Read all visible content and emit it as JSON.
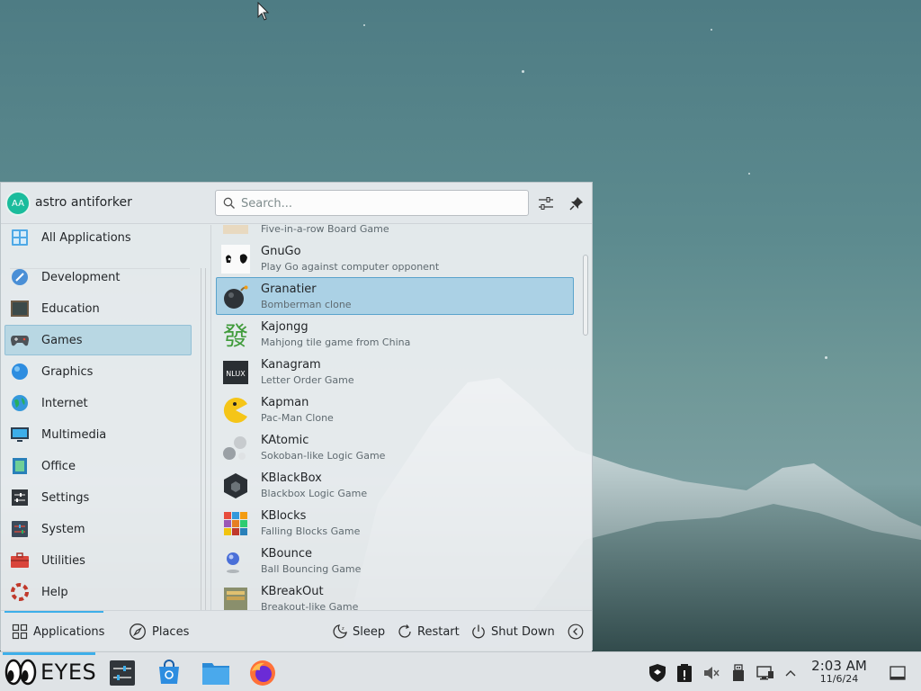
{
  "user": {
    "initials": "AA",
    "name": "astro antiforker"
  },
  "search": {
    "placeholder": "Search..."
  },
  "header_icons": [
    "configure-icon",
    "pin-icon"
  ],
  "categories": [
    {
      "label": "All Applications",
      "icon": "all-apps-icon"
    },
    {
      "label": "Development",
      "icon": "development-icon"
    },
    {
      "label": "Education",
      "icon": "education-icon"
    },
    {
      "label": "Games",
      "icon": "games-icon",
      "selected": true
    },
    {
      "label": "Graphics",
      "icon": "graphics-icon"
    },
    {
      "label": "Internet",
      "icon": "internet-icon"
    },
    {
      "label": "Multimedia",
      "icon": "multimedia-icon"
    },
    {
      "label": "Office",
      "icon": "office-icon"
    },
    {
      "label": "Settings",
      "icon": "settings-icon"
    },
    {
      "label": "System",
      "icon": "system-icon"
    },
    {
      "label": "Utilities",
      "icon": "utilities-icon"
    },
    {
      "label": "Help",
      "icon": "help-icon"
    }
  ],
  "apps": [
    {
      "name": "",
      "desc": "Five-in-a-row Board Game",
      "icon": "gomoku-icon"
    },
    {
      "name": "GnuGo",
      "desc": "Play Go against computer opponent",
      "icon": "gnugo-icon"
    },
    {
      "name": "Granatier",
      "desc": "Bomberman clone",
      "icon": "granatier-icon",
      "selected": true
    },
    {
      "name": "Kajongg",
      "desc": "Mahjong tile game from China",
      "icon": "kajongg-icon"
    },
    {
      "name": "Kanagram",
      "desc": "Letter Order Game",
      "icon": "kanagram-icon"
    },
    {
      "name": "Kapman",
      "desc": "Pac-Man Clone",
      "icon": "kapman-icon"
    },
    {
      "name": "KAtomic",
      "desc": "Sokoban-like Logic Game",
      "icon": "katomic-icon"
    },
    {
      "name": "KBlackBox",
      "desc": "Blackbox Logic Game",
      "icon": "kblackbox-icon"
    },
    {
      "name": "KBlocks",
      "desc": "Falling Blocks Game",
      "icon": "kblocks-icon"
    },
    {
      "name": "KBounce",
      "desc": "Ball Bouncing Game",
      "icon": "kbounce-icon"
    },
    {
      "name": "KBreakOut",
      "desc": "Breakout-like Game",
      "icon": "kbreakout-icon"
    }
  ],
  "footer": {
    "tabs": [
      {
        "label": "Applications",
        "active": true
      },
      {
        "label": "Places"
      }
    ],
    "actions": {
      "sleep": "Sleep",
      "restart": "Restart",
      "shutdown": "Shut Down"
    }
  },
  "taskbar": {
    "logo_text": "EYES",
    "apps": [
      "system-settings-icon",
      "discover-store-icon",
      "file-manager-icon",
      "firefox-icon"
    ],
    "tray": [
      "security-shield-icon",
      "clipboard-icon",
      "volume-muted-icon",
      "usb-device-icon",
      "network-icon",
      "expand-tray-icon"
    ],
    "clock": {
      "time": "2:03 AM",
      "date": "11/6/24"
    }
  },
  "colors": {
    "accent": "#3daee9",
    "selection": "#a4cee4",
    "panel": "#dfe3e6"
  }
}
